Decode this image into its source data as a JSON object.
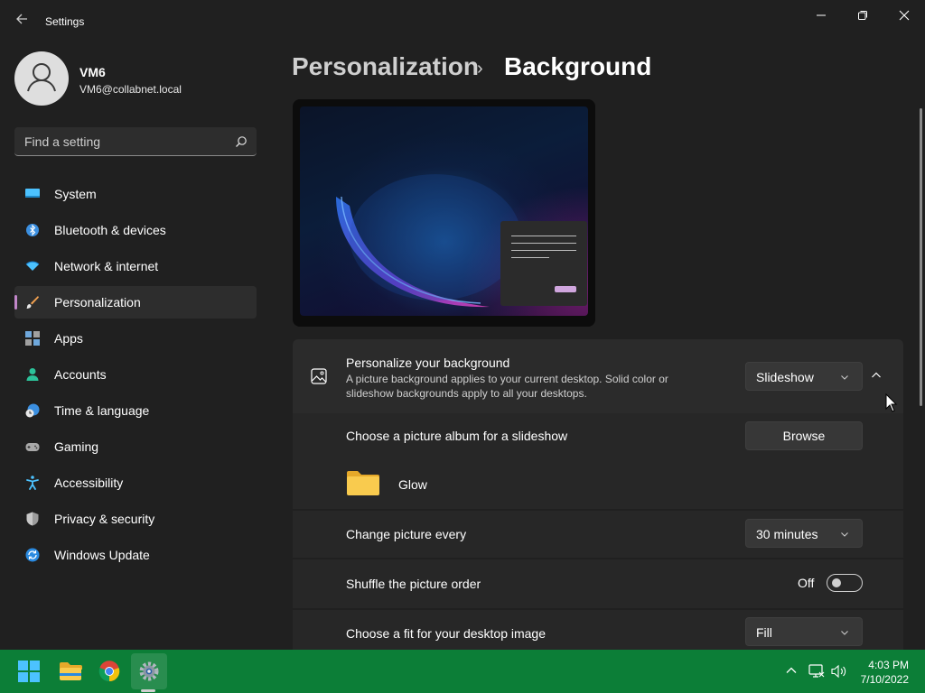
{
  "window": {
    "title": "Settings",
    "back_icon": "arrow-left-icon",
    "controls": [
      "minimize-icon",
      "restore-icon",
      "close-icon"
    ]
  },
  "user": {
    "name": "VM6",
    "email": "VM6@collabnet.local"
  },
  "search": {
    "placeholder": "Find a setting"
  },
  "sidebar": {
    "items": [
      {
        "label": "System",
        "icon": "monitor-icon",
        "active": false
      },
      {
        "label": "Bluetooth & devices",
        "icon": "bluetooth-icon",
        "active": false
      },
      {
        "label": "Network & internet",
        "icon": "wifi-icon",
        "active": false
      },
      {
        "label": "Personalization",
        "icon": "brush-icon",
        "active": true
      },
      {
        "label": "Apps",
        "icon": "apps-icon",
        "active": false
      },
      {
        "label": "Accounts",
        "icon": "person-icon",
        "active": false
      },
      {
        "label": "Time & language",
        "icon": "clock-globe-icon",
        "active": false
      },
      {
        "label": "Gaming",
        "icon": "gamepad-icon",
        "active": false
      },
      {
        "label": "Accessibility",
        "icon": "accessibility-icon",
        "active": false
      },
      {
        "label": "Privacy & security",
        "icon": "shield-icon",
        "active": false
      },
      {
        "label": "Windows Update",
        "icon": "update-icon",
        "active": false
      }
    ]
  },
  "breadcrumb": {
    "parent": "Personalization",
    "separator": "›",
    "current": "Background"
  },
  "background_card": {
    "title": "Personalize your background",
    "description": "A picture background applies to your current desktop. Solid color or slideshow backgrounds apply to all your desktops.",
    "dropdown_value": "Slideshow",
    "expanded": true
  },
  "album": {
    "label": "Choose a picture album for a slideshow",
    "browse_label": "Browse",
    "folder_name": "Glow"
  },
  "change_picture": {
    "label": "Change picture every",
    "value": "30 minutes"
  },
  "shuffle": {
    "label": "Shuffle the picture order",
    "state_label": "Off"
  },
  "fit": {
    "label": "Choose a fit for your desktop image",
    "value": "Fill"
  },
  "taskbar": {
    "apps": [
      "windows-start-icon",
      "file-explorer-icon",
      "chrome-icon",
      "settings-icon"
    ],
    "active_app": "settings-icon",
    "tray": [
      "chevron-up-icon",
      "network-icon",
      "volume-icon"
    ],
    "time": "4:03 PM",
    "date": "7/10/2022",
    "color": "#0c7e37"
  }
}
